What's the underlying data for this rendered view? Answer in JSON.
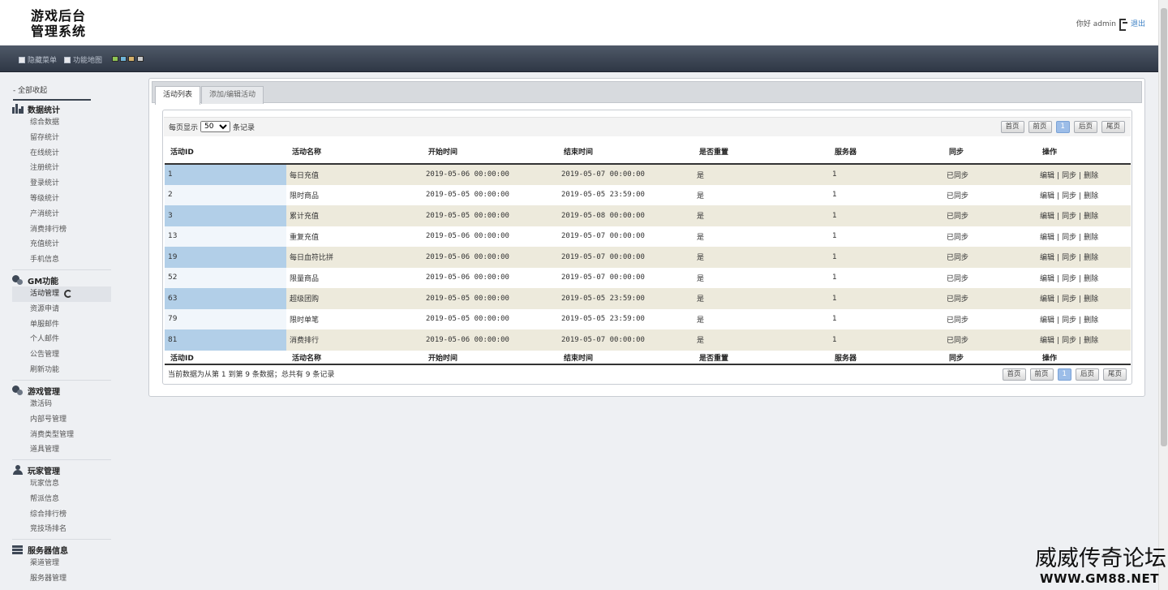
{
  "header": {
    "logo_line1": "游戏后台",
    "logo_line2": "管理系统",
    "greeting": "你好 admin",
    "logout": "退出"
  },
  "topbar": {
    "hide_menu": "隐藏菜单",
    "function_map": "功能地图",
    "theme_colors": [
      "#8fc454",
      "#6fb4d8",
      "#d4b06a",
      "#c8c8c8"
    ]
  },
  "sidebar": {
    "collapse_all": "- 全部收起",
    "groups": [
      {
        "title": "数据统计",
        "items": [
          "综合数据",
          "留存统计",
          "在线统计",
          "注册统计",
          "登录统计",
          "等级统计",
          "产消统计",
          "消费排行榜",
          "充值统计",
          "手机信息"
        ]
      },
      {
        "title": "GM功能",
        "items": [
          "活动管理",
          "资源申请",
          "单服邮件",
          "个人邮件",
          "公告管理",
          "刷新功能"
        ]
      },
      {
        "title": "游戏管理",
        "items": [
          "激活码",
          "内部号管理",
          "消费类型管理",
          "道具管理"
        ]
      },
      {
        "title": "玩家管理",
        "items": [
          "玩家信息",
          "帮派信息",
          "综合排行榜",
          "竞技场排名"
        ]
      },
      {
        "title": "服务器信息",
        "items": [
          "渠道管理",
          "服务器管理"
        ]
      }
    ]
  },
  "tabs": [
    "活动列表",
    "添加/编辑活动"
  ],
  "table": {
    "per_page_label": "每页显示",
    "per_page_value": "50",
    "per_page_suffix": "条记录",
    "columns": [
      "活动ID",
      "活动名称",
      "开始时间",
      "结束时间",
      "是否重置",
      "服务器",
      "同步",
      "操作"
    ],
    "rows": [
      {
        "id": "1",
        "name": "每日充值",
        "start": "2019-05-06 00:00:00",
        "end": "2019-05-07 00:00:00",
        "reset": "是",
        "server": "1",
        "sync": "已同步"
      },
      {
        "id": "2",
        "name": "限时商品",
        "start": "2019-05-05 00:00:00",
        "end": "2019-05-05 23:59:00",
        "reset": "是",
        "server": "1",
        "sync": "已同步"
      },
      {
        "id": "3",
        "name": "累计充值",
        "start": "2019-05-05 00:00:00",
        "end": "2019-05-08 00:00:00",
        "reset": "是",
        "server": "1",
        "sync": "已同步"
      },
      {
        "id": "13",
        "name": "重复充值",
        "start": "2019-05-06 00:00:00",
        "end": "2019-05-07 00:00:00",
        "reset": "是",
        "server": "1",
        "sync": "已同步"
      },
      {
        "id": "19",
        "name": "每日血符比拼",
        "start": "2019-05-06 00:00:00",
        "end": "2019-05-07 00:00:00",
        "reset": "是",
        "server": "1",
        "sync": "已同步"
      },
      {
        "id": "52",
        "name": "限量商品",
        "start": "2019-05-06 00:00:00",
        "end": "2019-05-07 00:00:00",
        "reset": "是",
        "server": "1",
        "sync": "已同步"
      },
      {
        "id": "63",
        "name": "超级团购",
        "start": "2019-05-05 00:00:00",
        "end": "2019-05-05 23:59:00",
        "reset": "是",
        "server": "1",
        "sync": "已同步"
      },
      {
        "id": "79",
        "name": "限时单笔",
        "start": "2019-05-05 00:00:00",
        "end": "2019-05-05 23:59:00",
        "reset": "是",
        "server": "1",
        "sync": "已同步"
      },
      {
        "id": "81",
        "name": "消费排行",
        "start": "2019-05-06 00:00:00",
        "end": "2019-05-07 00:00:00",
        "reset": "是",
        "server": "1",
        "sync": "已同步"
      }
    ],
    "ops": [
      "编辑",
      "同步",
      "删除"
    ],
    "summary": "当前数据为从第 1 到第 9 条数据；总共有 9 条记录"
  },
  "pager": {
    "first": "首页",
    "prev": "前页",
    "current": "1",
    "next": "后页",
    "last": "尾页"
  },
  "watermark": {
    "line1": "威威传奇论坛",
    "line2": "WWW.GM88.NET"
  }
}
